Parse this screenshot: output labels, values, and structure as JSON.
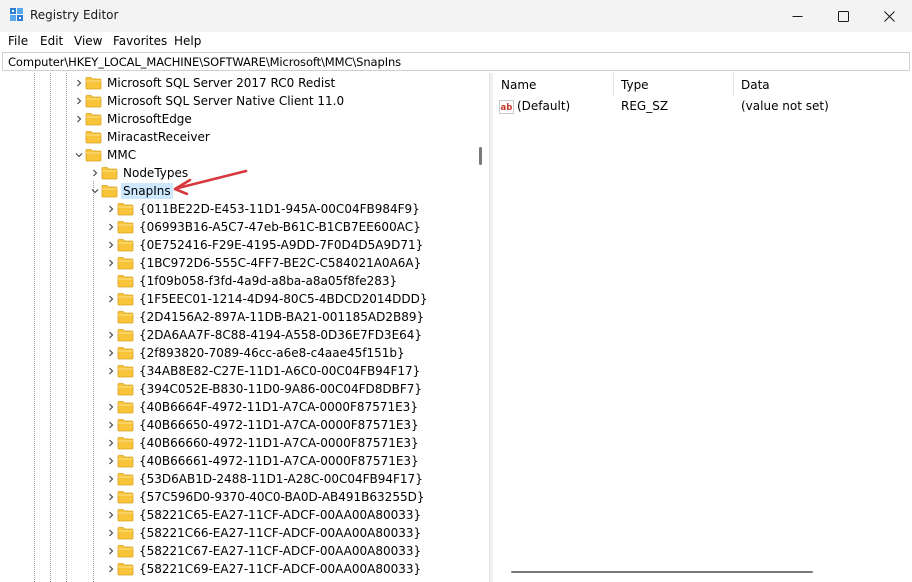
{
  "window": {
    "title": "Registry Editor",
    "icon": "registry-editor-icon",
    "controls": [
      "minimize-icon",
      "maximize-icon",
      "close-icon"
    ]
  },
  "menu": [
    "File",
    "Edit",
    "View",
    "Favorites",
    "Help"
  ],
  "address": "Computer\\HKEY_LOCAL_MACHINE\\SOFTWARE\\Microsoft\\MMC\\SnapIns",
  "tree": {
    "nodes": [
      {
        "label": "Microsoft SQL Server 2017 RC0 Redist",
        "level": 0,
        "expander": "collapsed"
      },
      {
        "label": "Microsoft SQL Server Native Client 11.0",
        "level": 0,
        "expander": "collapsed"
      },
      {
        "label": "MicrosoftEdge",
        "level": 0,
        "expander": "collapsed"
      },
      {
        "label": "MiracastReceiver",
        "level": 0,
        "expander": "none"
      },
      {
        "label": "MMC",
        "level": 0,
        "expander": "expanded"
      },
      {
        "label": "NodeTypes",
        "level": 1,
        "expander": "collapsed"
      },
      {
        "label": "SnapIns",
        "level": 1,
        "expander": "expanded",
        "selected": true
      },
      {
        "label": "{011BE22D-E453-11D1-945A-00C04FB984F9}",
        "level": 2,
        "expander": "collapsed"
      },
      {
        "label": "{06993B16-A5C7-47eb-B61C-B1CB7EE600AC}",
        "level": 2,
        "expander": "collapsed"
      },
      {
        "label": "{0E752416-F29E-4195-A9DD-7F0D4D5A9D71}",
        "level": 2,
        "expander": "collapsed"
      },
      {
        "label": "{1BC972D6-555C-4FF7-BE2C-C584021A0A6A}",
        "level": 2,
        "expander": "collapsed"
      },
      {
        "label": "{1f09b058-f3fd-4a9d-a8ba-a8a05f8fe283}",
        "level": 2,
        "expander": "none"
      },
      {
        "label": "{1F5EEC01-1214-4D94-80C5-4BDCD2014DDD}",
        "level": 2,
        "expander": "collapsed"
      },
      {
        "label": "{2D4156A2-897A-11DB-BA21-001185AD2B89}",
        "level": 2,
        "expander": "none"
      },
      {
        "label": "{2DA6AA7F-8C88-4194-A558-0D36E7FD3E64}",
        "level": 2,
        "expander": "collapsed"
      },
      {
        "label": "{2f893820-7089-46cc-a6e8-c4aae45f151b}",
        "level": 2,
        "expander": "collapsed"
      },
      {
        "label": "{34AB8E82-C27E-11D1-A6C0-00C04FB94F17}",
        "level": 2,
        "expander": "collapsed"
      },
      {
        "label": "{394C052E-B830-11D0-9A86-00C04FD8DBF7}",
        "level": 2,
        "expander": "none"
      },
      {
        "label": "{40B6664F-4972-11D1-A7CA-0000F87571E3}",
        "level": 2,
        "expander": "collapsed"
      },
      {
        "label": "{40B66650-4972-11D1-A7CA-0000F87571E3}",
        "level": 2,
        "expander": "collapsed"
      },
      {
        "label": "{40B66660-4972-11D1-A7CA-0000F87571E3}",
        "level": 2,
        "expander": "collapsed"
      },
      {
        "label": "{40B66661-4972-11D1-A7CA-0000F87571E3}",
        "level": 2,
        "expander": "collapsed"
      },
      {
        "label": "{53D6AB1D-2488-11D1-A28C-00C04FB94F17}",
        "level": 2,
        "expander": "collapsed"
      },
      {
        "label": "{57C596D0-9370-40C0-BA0D-AB491B63255D}",
        "level": 2,
        "expander": "collapsed"
      },
      {
        "label": "{58221C65-EA27-11CF-ADCF-00AA00A80033}",
        "level": 2,
        "expander": "collapsed"
      },
      {
        "label": "{58221C66-EA27-11CF-ADCF-00AA00A80033}",
        "level": 2,
        "expander": "collapsed"
      },
      {
        "label": "{58221C67-EA27-11CF-ADCF-00AA00A80033}",
        "level": 2,
        "expander": "collapsed"
      },
      {
        "label": "{58221C69-EA27-11CF-ADCF-00AA00A80033}",
        "level": 2,
        "expander": "collapsed"
      }
    ]
  },
  "values": {
    "columns": [
      "Name",
      "Type",
      "Data"
    ],
    "rows": [
      {
        "name": "(Default)",
        "type": "REG_SZ",
        "data": "(value not set)",
        "icon": "string-value-icon"
      }
    ]
  },
  "colors": {
    "selection": "#cde8ff",
    "folder": "#f8c53a",
    "annotation_arrow": "#d9373e",
    "string_icon": "#c4372b"
  }
}
